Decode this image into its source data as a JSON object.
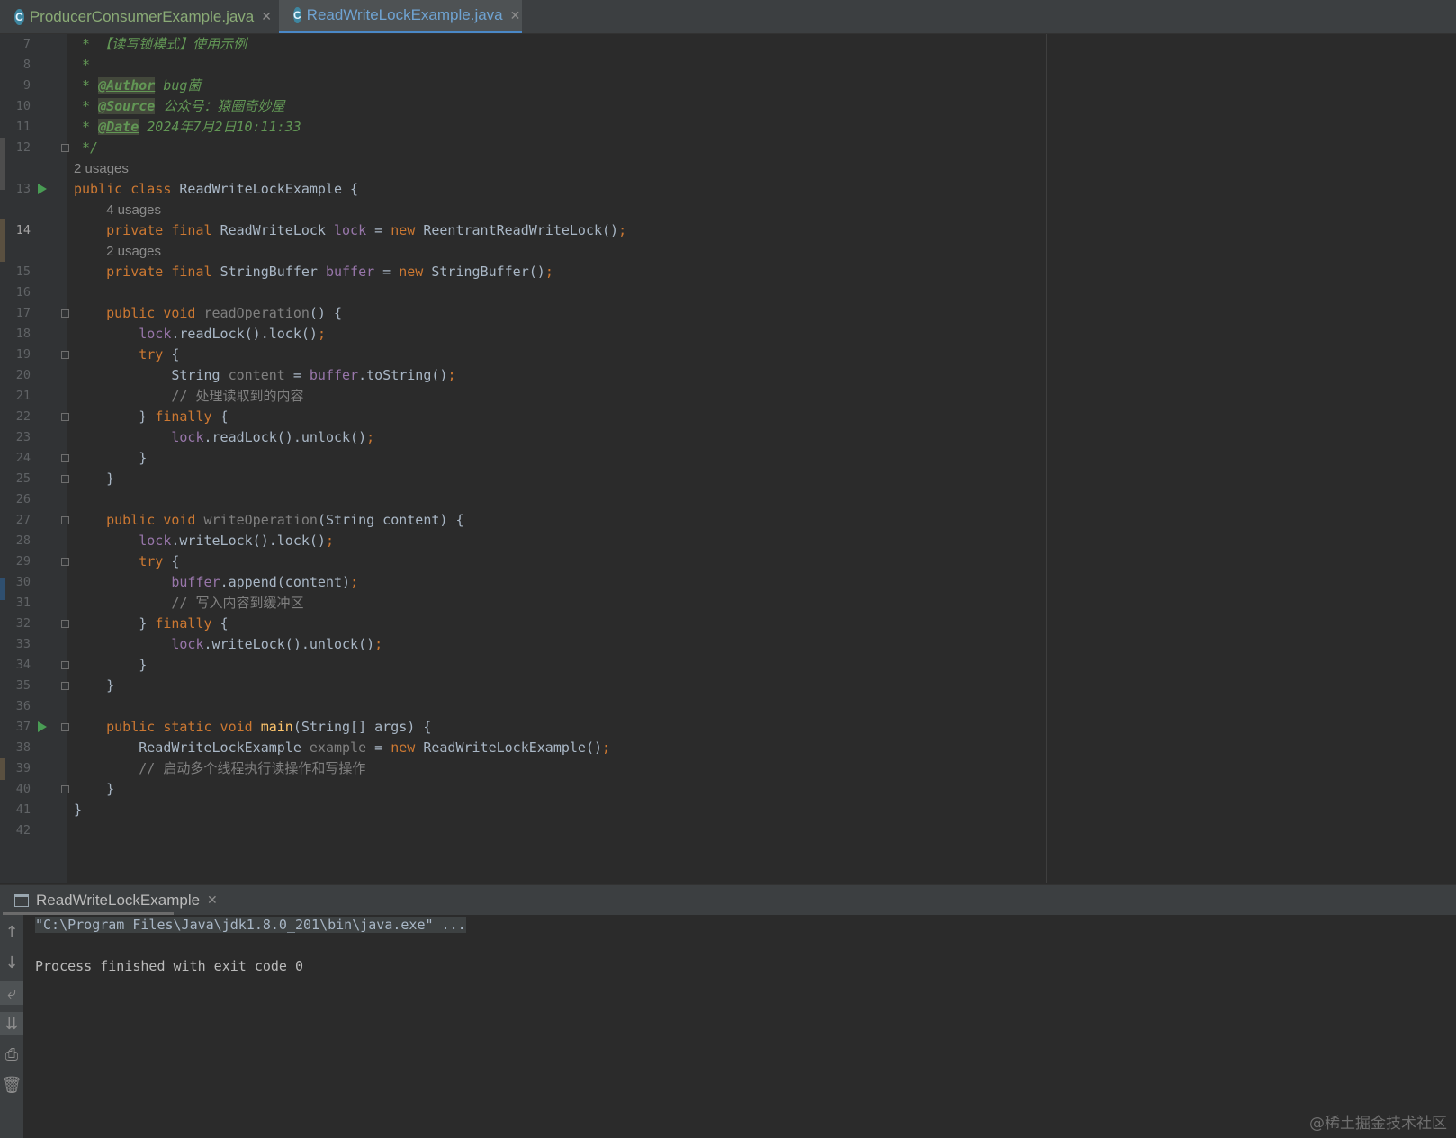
{
  "tabs": [
    {
      "label": "ProducerConsumerExample.java",
      "icon": "java-class-icon",
      "active": false
    },
    {
      "label": "ReadWriteLockExample.java",
      "icon": "java-class-icon",
      "active": true
    }
  ],
  "editor": {
    "current_line": "14",
    "rows": [
      {
        "n": "7",
        "fold": false,
        "run": false,
        "spans": [
          [
            " * 【读写锁模式】使用示例",
            "doc"
          ]
        ]
      },
      {
        "n": "8",
        "fold": false,
        "run": false,
        "spans": [
          [
            " *",
            "doc"
          ]
        ]
      },
      {
        "n": "9",
        "fold": false,
        "run": false,
        "spans": [
          [
            " * ",
            "doc"
          ],
          [
            "@Author",
            "tag"
          ],
          [
            " bug菌",
            "doc"
          ]
        ]
      },
      {
        "n": "10",
        "fold": false,
        "run": false,
        "spans": [
          [
            " * ",
            "doc"
          ],
          [
            "@Source",
            "tag"
          ],
          [
            " 公众号：猿圈奇妙屋",
            "doc"
          ]
        ]
      },
      {
        "n": "11",
        "fold": false,
        "run": false,
        "spans": [
          [
            " * ",
            "doc"
          ],
          [
            "@Date",
            "tag"
          ],
          [
            " 2024年7月2日10:11:33",
            "doc"
          ]
        ]
      },
      {
        "n": "12",
        "fold": true,
        "run": false,
        "spans": [
          [
            " */",
            "doc"
          ]
        ]
      },
      {
        "n": "",
        "fold": false,
        "run": false,
        "spans": [
          [
            "2 usages",
            "usage"
          ]
        ]
      },
      {
        "n": "13",
        "fold": false,
        "run": true,
        "spans": [
          [
            "public class ",
            "kw"
          ],
          [
            "ReadWriteLockExample {",
            ""
          ]
        ]
      },
      {
        "n": "",
        "fold": false,
        "run": false,
        "spans": [
          [
            "    ",
            ""
          ],
          [
            "4 usages",
            "usage"
          ]
        ]
      },
      {
        "n": "14",
        "fold": false,
        "run": false,
        "hl": true,
        "spans": [
          [
            "    ",
            ""
          ],
          [
            "private final ",
            "kw"
          ],
          [
            "ReadWriteLock ",
            ""
          ],
          [
            "lock",
            "fld"
          ],
          [
            " = ",
            ""
          ],
          [
            "new ",
            "kw"
          ],
          [
            "ReentrantReadWriteLock()",
            ""
          ],
          [
            ";",
            "kw"
          ]
        ]
      },
      {
        "n": "",
        "fold": false,
        "run": false,
        "spans": [
          [
            "    ",
            ""
          ],
          [
            "2 usages",
            "usage"
          ]
        ]
      },
      {
        "n": "15",
        "fold": false,
        "run": false,
        "spans": [
          [
            "    ",
            ""
          ],
          [
            "private final ",
            "kw"
          ],
          [
            "StringBuffer ",
            ""
          ],
          [
            "buffer",
            "fld"
          ],
          [
            " = ",
            ""
          ],
          [
            "new ",
            "kw"
          ],
          [
            "StringBuffer()",
            ""
          ],
          [
            ";",
            "kw"
          ]
        ]
      },
      {
        "n": "16",
        "fold": false,
        "run": false,
        "spans": []
      },
      {
        "n": "17",
        "fold": true,
        "run": false,
        "spans": [
          [
            "    ",
            ""
          ],
          [
            "public void ",
            "kw"
          ],
          [
            "readOperation",
            "unused"
          ],
          [
            "() {",
            ""
          ]
        ]
      },
      {
        "n": "18",
        "fold": false,
        "run": false,
        "spans": [
          [
            "        ",
            ""
          ],
          [
            "lock",
            "fld"
          ],
          [
            ".readLock().lock()",
            ""
          ],
          [
            ";",
            "kw"
          ]
        ]
      },
      {
        "n": "19",
        "fold": true,
        "run": false,
        "spans": [
          [
            "        ",
            ""
          ],
          [
            "try ",
            "kw"
          ],
          [
            "{",
            ""
          ]
        ]
      },
      {
        "n": "20",
        "fold": false,
        "run": false,
        "spans": [
          [
            "            String ",
            ""
          ],
          [
            "content",
            "unused"
          ],
          [
            " = ",
            ""
          ],
          [
            "buffer",
            "fld"
          ],
          [
            ".toString()",
            ""
          ],
          [
            ";",
            "kw"
          ]
        ]
      },
      {
        "n": "21",
        "fold": false,
        "run": false,
        "spans": [
          [
            "            ",
            ""
          ],
          [
            "// 处理读取到的内容",
            "cmt"
          ]
        ]
      },
      {
        "n": "22",
        "fold": true,
        "run": false,
        "spans": [
          [
            "        } ",
            ""
          ],
          [
            "finally ",
            "kw"
          ],
          [
            "{",
            ""
          ]
        ]
      },
      {
        "n": "23",
        "fold": false,
        "run": false,
        "spans": [
          [
            "            ",
            ""
          ],
          [
            "lock",
            "fld"
          ],
          [
            ".readLock().unlock()",
            ""
          ],
          [
            ";",
            "kw"
          ]
        ]
      },
      {
        "n": "24",
        "fold": true,
        "run": false,
        "spans": [
          [
            "        }",
            ""
          ]
        ]
      },
      {
        "n": "25",
        "fold": true,
        "run": false,
        "spans": [
          [
            "    }",
            ""
          ]
        ]
      },
      {
        "n": "26",
        "fold": false,
        "run": false,
        "spans": []
      },
      {
        "n": "27",
        "fold": true,
        "run": false,
        "spans": [
          [
            "    ",
            ""
          ],
          [
            "public void ",
            "kw"
          ],
          [
            "writeOperation",
            "unused"
          ],
          [
            "(String content) {",
            ""
          ]
        ]
      },
      {
        "n": "28",
        "fold": false,
        "run": false,
        "spans": [
          [
            "        ",
            ""
          ],
          [
            "lock",
            "fld"
          ],
          [
            ".writeLock().lock()",
            ""
          ],
          [
            ";",
            "kw"
          ]
        ]
      },
      {
        "n": "29",
        "fold": true,
        "run": false,
        "spans": [
          [
            "        ",
            ""
          ],
          [
            "try ",
            "kw"
          ],
          [
            "{",
            ""
          ]
        ]
      },
      {
        "n": "30",
        "fold": false,
        "run": false,
        "spans": [
          [
            "            ",
            ""
          ],
          [
            "buffer",
            "fld"
          ],
          [
            ".append(content)",
            ""
          ],
          [
            ";",
            "kw"
          ]
        ]
      },
      {
        "n": "31",
        "fold": false,
        "run": false,
        "spans": [
          [
            "            ",
            ""
          ],
          [
            "// 写入内容到缓冲区",
            "cmt"
          ]
        ]
      },
      {
        "n": "32",
        "fold": true,
        "run": false,
        "spans": [
          [
            "        } ",
            ""
          ],
          [
            "finally ",
            "kw"
          ],
          [
            "{",
            ""
          ]
        ]
      },
      {
        "n": "33",
        "fold": false,
        "run": false,
        "spans": [
          [
            "            ",
            ""
          ],
          [
            "lock",
            "fld"
          ],
          [
            ".writeLock().unlock()",
            ""
          ],
          [
            ";",
            "kw"
          ]
        ]
      },
      {
        "n": "34",
        "fold": true,
        "run": false,
        "spans": [
          [
            "        }",
            ""
          ]
        ]
      },
      {
        "n": "35",
        "fold": true,
        "run": false,
        "spans": [
          [
            "    }",
            ""
          ]
        ]
      },
      {
        "n": "36",
        "fold": false,
        "run": false,
        "spans": []
      },
      {
        "n": "37",
        "fold": true,
        "run": true,
        "spans": [
          [
            "    ",
            ""
          ],
          [
            "public static void ",
            "kw"
          ],
          [
            "main",
            "method"
          ],
          [
            "(String[] args) {",
            ""
          ]
        ]
      },
      {
        "n": "38",
        "fold": false,
        "run": false,
        "spans": [
          [
            "        ReadWriteLockExample ",
            ""
          ],
          [
            "example",
            "unused"
          ],
          [
            " = ",
            ""
          ],
          [
            "new ",
            "kw"
          ],
          [
            "ReadWriteLockExample()",
            ""
          ],
          [
            ";",
            "kw"
          ]
        ]
      },
      {
        "n": "39",
        "fold": false,
        "run": false,
        "spans": [
          [
            "        ",
            ""
          ],
          [
            "// 启动多个线程执行读操作和写操作",
            "cmt"
          ]
        ]
      },
      {
        "n": "40",
        "fold": true,
        "run": false,
        "spans": [
          [
            "    }",
            ""
          ]
        ]
      },
      {
        "n": "41",
        "fold": false,
        "run": false,
        "spans": [
          [
            "}",
            ""
          ]
        ]
      },
      {
        "n": "42",
        "fold": false,
        "run": false,
        "spans": []
      }
    ]
  },
  "run_panel": {
    "tab_label": "ReadWriteLockExample",
    "console_lines": [
      "\"C:\\Program Files\\Java\\jdk1.8.0_201\\bin\\java.exe\" ...",
      "",
      "Process finished with exit code 0"
    ],
    "side_buttons": [
      "arrow-up-icon",
      "arrow-down-icon",
      "soft-wrap-icon",
      "scroll-to-end-icon",
      "print-icon",
      "trash-icon"
    ]
  },
  "watermark": "@稀土掘金技术社区",
  "colors": {
    "keyword": "#cc7832",
    "field": "#9876aa",
    "doc_comment": "#629755",
    "comment": "#808080",
    "method": "#ffc66d"
  }
}
